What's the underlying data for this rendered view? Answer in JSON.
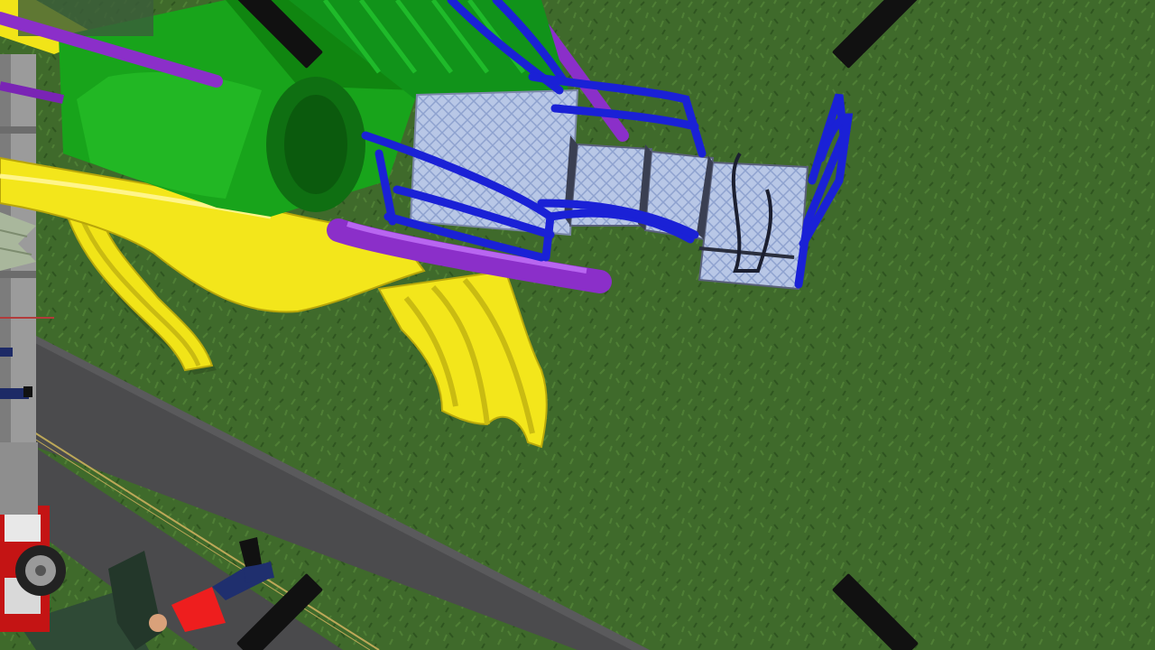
{
  "view": {
    "mode": "drone-camera-overhead",
    "ground_color": "#3f6a2b",
    "road_color": "#4a4a4a",
    "playground_colors": {
      "yellow": "#f2e61a",
      "green": "#16a21a",
      "purple": "#8b2fc9",
      "blue": "#1a21d6",
      "platform": "#b9c6e3"
    }
  },
  "icons": {
    "reticle": "camera-frame-brackets",
    "person": "pedestrian-figure",
    "vehicle": "fire-truck"
  }
}
